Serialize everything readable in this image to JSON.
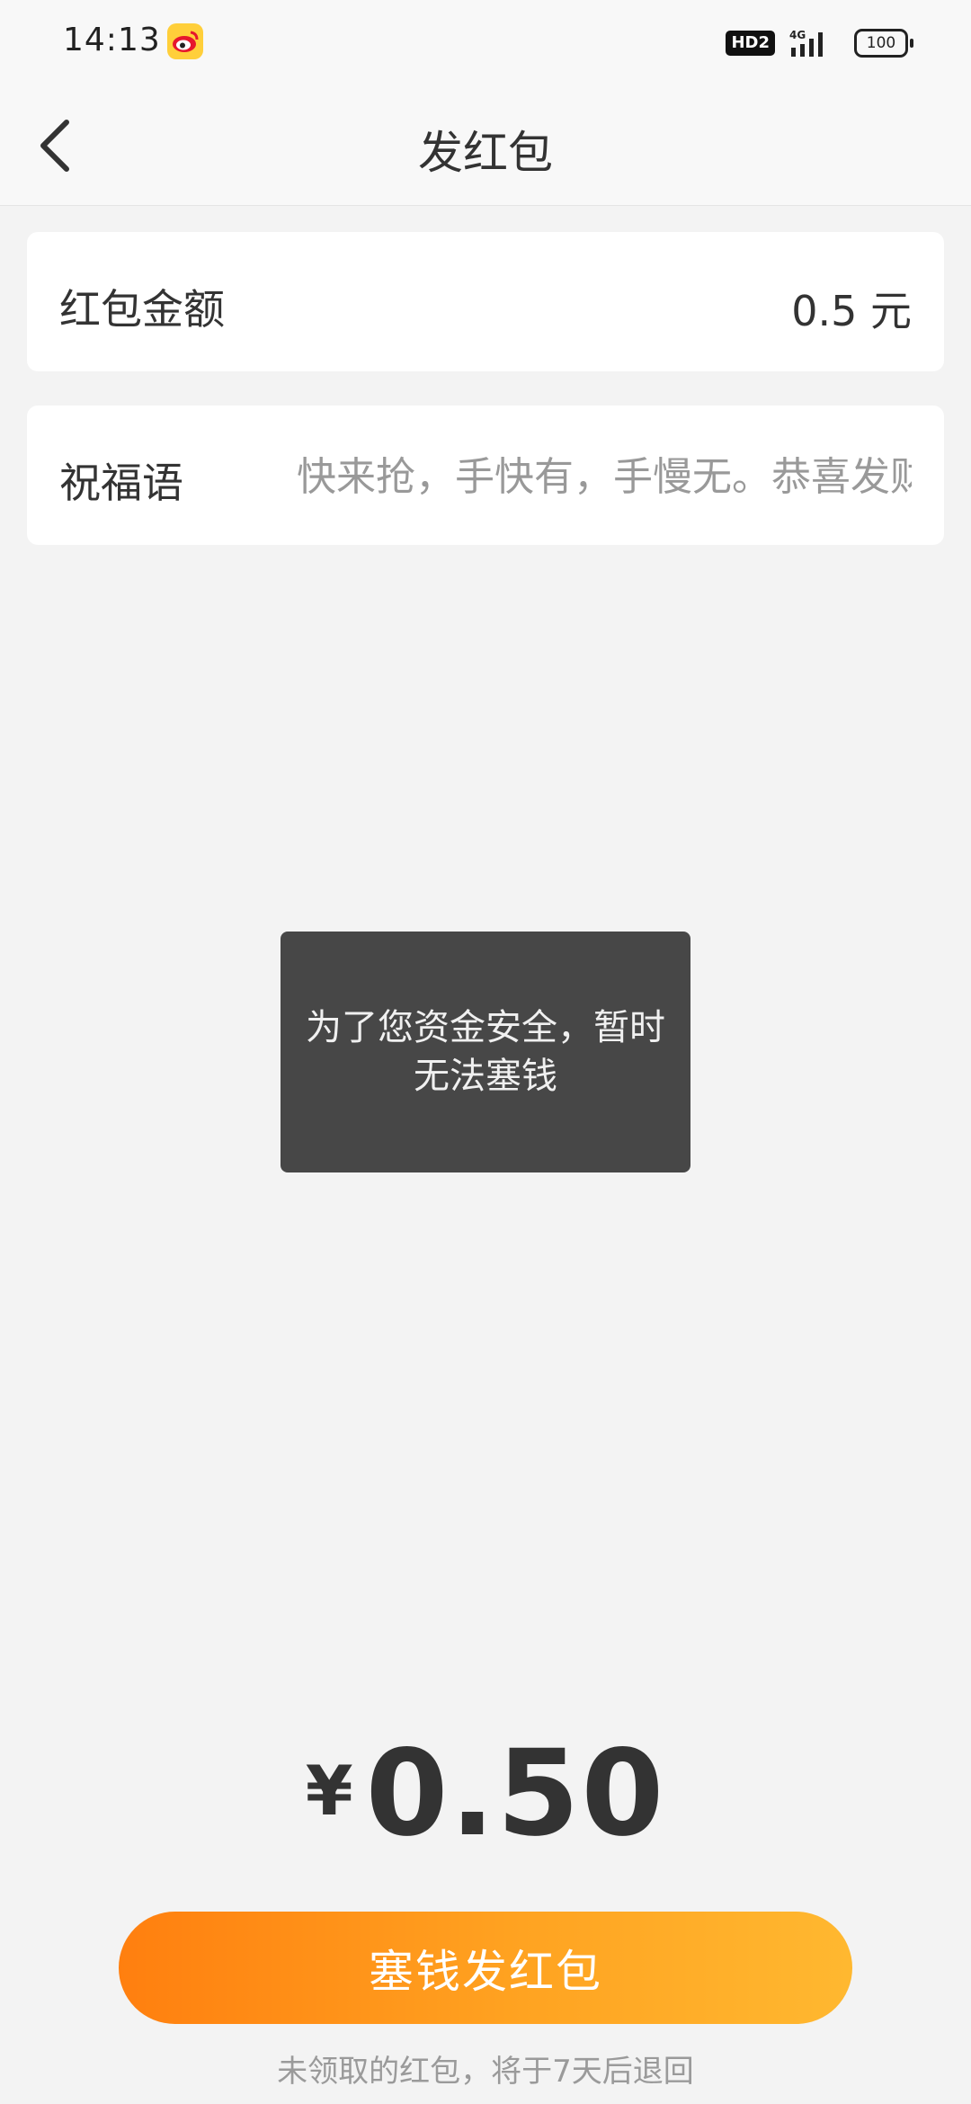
{
  "status_bar": {
    "time": "14:13",
    "app_icon": "weibo-icon",
    "network_badge": "HD2",
    "signal": "4G",
    "battery": "100"
  },
  "nav": {
    "back_icon": "chevron-left-icon",
    "title": "发红包"
  },
  "amount_card": {
    "label": "红包金额",
    "value": "0.5 元"
  },
  "blessing_card": {
    "label": "祝福语",
    "placeholder": "快来抢，手快有，手慢无。恭喜发财"
  },
  "toast": {
    "message": "为了您资金安全，暂时无法塞钱"
  },
  "total": {
    "currency": "¥",
    "amount": "0.50"
  },
  "send_button": {
    "label": "塞钱发红包"
  },
  "footnote": "未领取的红包，将于7天后退回",
  "colors": {
    "accent_start": "#ff7f0f",
    "accent_end": "#ffb830",
    "toast_bg": "#474747"
  }
}
